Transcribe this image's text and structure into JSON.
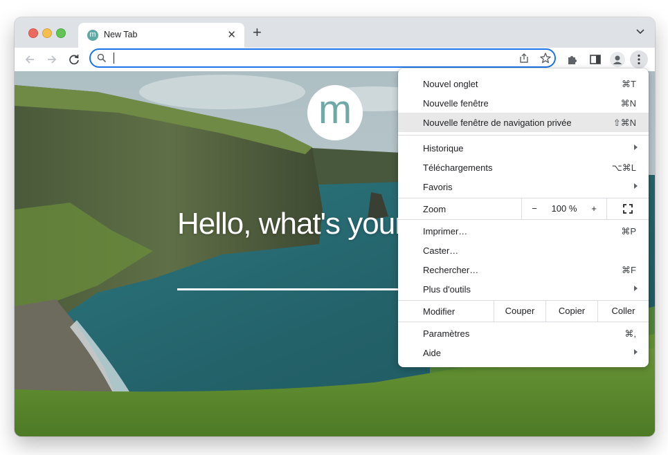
{
  "browser": {
    "tab": {
      "title": "New Tab",
      "favicon_letter": "m",
      "close_glyph": "✕"
    },
    "new_tab_glyph": "+",
    "omnibox": {
      "value": "",
      "placeholder": ""
    },
    "accent_color": "#1a73e8"
  },
  "page": {
    "logo_letter": "m",
    "greeting": "Hello, what's your"
  },
  "menu": {
    "items_top": [
      {
        "label": "Nouvel onglet",
        "shortcut": "⌘T"
      },
      {
        "label": "Nouvelle fenêtre",
        "shortcut": "⌘N"
      },
      {
        "label": "Nouvelle fenêtre de navigation privée",
        "shortcut": "⇧⌘N"
      }
    ],
    "items_mid": [
      {
        "label": "Historique",
        "shortcut": ""
      },
      {
        "label": "Téléchargements",
        "shortcut": "⌥⌘L"
      },
      {
        "label": "Favoris",
        "shortcut": ""
      }
    ],
    "zoom": {
      "label": "Zoom",
      "minus": "−",
      "value": "100 %",
      "plus": "+"
    },
    "items_tools": [
      {
        "label": "Imprimer…",
        "shortcut": "⌘P"
      },
      {
        "label": "Caster…",
        "shortcut": ""
      },
      {
        "label": "Rechercher…",
        "shortcut": "⌘F"
      },
      {
        "label": "Plus d'outils",
        "shortcut": ""
      }
    ],
    "edit": {
      "label": "Modifier",
      "cut": "Couper",
      "copy": "Copier",
      "paste": "Coller"
    },
    "items_bottom": [
      {
        "label": "Paramètres",
        "shortcut": "⌘,"
      },
      {
        "label": "Aide",
        "shortcut": ""
      }
    ]
  }
}
